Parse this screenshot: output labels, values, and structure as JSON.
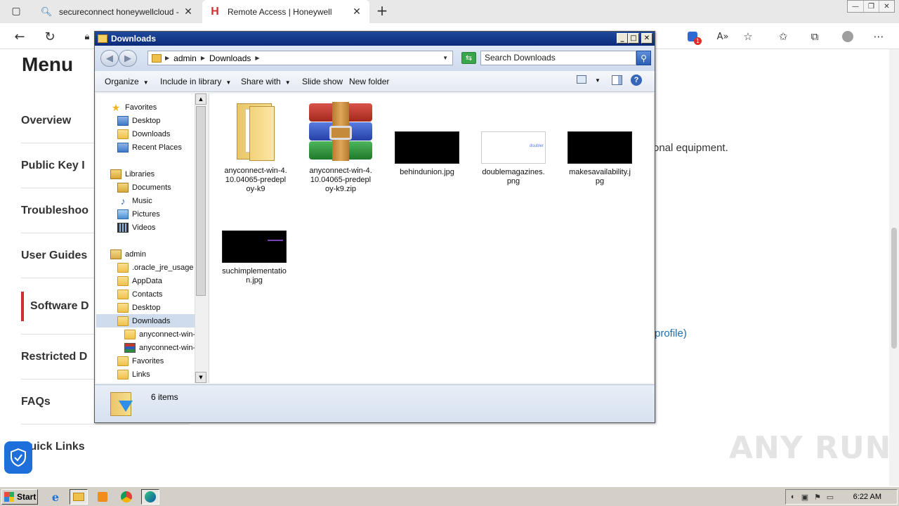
{
  "browser": {
    "tabs": [
      {
        "title": "secureconnect honeywellcloud -",
        "close": "✕"
      },
      {
        "title": "Remote Access | Honeywell",
        "close": "✕"
      }
    ],
    "new_tab": "+",
    "window_buttons": [
      "—",
      "❐",
      "✕"
    ],
    "badge_count": "1"
  },
  "page": {
    "menu_title": "Menu",
    "menu_items": [
      "Overview",
      "Public Key I",
      "Troubleshoo",
      "User Guides",
      "Software D",
      "Restricted D",
      "FAQs",
      "Quick Links"
    ],
    "body_text": "onal equipment.",
    "link_text": "profile)",
    "watermark": "ANY RUN"
  },
  "explorer": {
    "title": "Downloads",
    "breadcrumb": [
      "admin",
      "Downloads"
    ],
    "search_placeholder": "Search Downloads",
    "toolbar": {
      "organize": "Organize",
      "include": "Include in library",
      "share": "Share with",
      "slideshow": "Slide show",
      "newfolder": "New folder"
    },
    "tree": {
      "favorites": "Favorites",
      "desktop": "Desktop",
      "downloads": "Downloads",
      "recent": "Recent Places",
      "libraries": "Libraries",
      "documents": "Documents",
      "music": "Music",
      "pictures": "Pictures",
      "videos": "Videos",
      "admin": "admin",
      "oracle": ".oracle_jre_usage",
      "appdata": "AppData",
      "contacts": "Contacts",
      "desktop2": "Desktop",
      "downloads2": "Downloads",
      "anyconnect1": "anyconnect-win-",
      "anyconnect2": "anyconnect-win-",
      "favorites2": "Favorites",
      "links": "Links"
    },
    "files": [
      {
        "name": "anyconnect-win-4.10.04065-predeploy-k9"
      },
      {
        "name": "anyconnect-win-4.10.04065-predeploy-k9.zip"
      },
      {
        "name": "behindunion.jpg"
      },
      {
        "name": "doublemagazines.png",
        "thumb_text": "doubler"
      },
      {
        "name": "makesavailability.jpg"
      },
      {
        "name": "suchimplementation.jpg"
      }
    ],
    "status": "6 items"
  },
  "taskbar": {
    "start": "Start",
    "clock": "6:22 AM"
  },
  "colors": {
    "honeywell_red": "#d32f2f",
    "link_blue": "#1a6fb3",
    "xp_title_blue": "#0a2a7a"
  }
}
